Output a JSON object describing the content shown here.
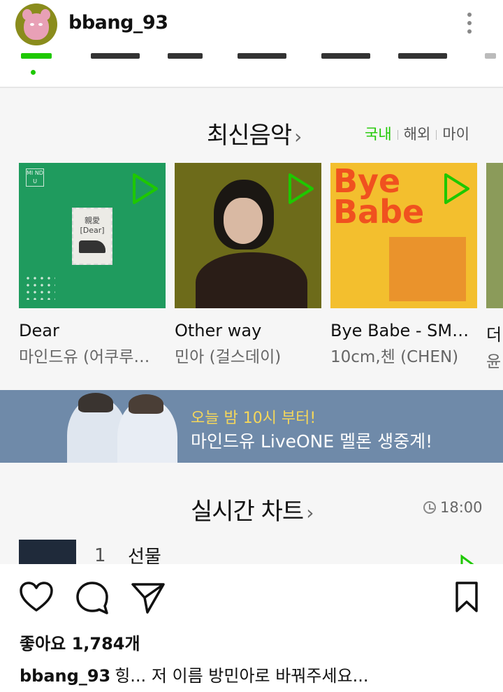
{
  "post": {
    "username": "bbang_93",
    "likes_label": "좋아요 1,784개",
    "caption_user": "bbang_93",
    "caption_text": "힝... 저 이름 방민아로 바꿔주세요..."
  },
  "melon": {
    "latest": {
      "title": "최신음악",
      "filters": [
        "국내",
        "해외",
        "마이"
      ],
      "active_filter": "국내",
      "albums": [
        {
          "title": "Dear",
          "artist": "마인드유 (어쿠루…",
          "art_text": "親愛 [Dear]"
        },
        {
          "title": "Other way",
          "artist": "민아 (걸스데이)"
        },
        {
          "title": "Bye Babe - SM…",
          "artist": "10cm,첸 (CHEN)",
          "art_text": "Bye Babe"
        },
        {
          "title": "더",
          "artist": "윤"
        }
      ]
    },
    "banner": {
      "line1": "오늘 밤 10시 부터!",
      "line2": "마인드유 LiveONE 멜론 생중계!"
    },
    "chart": {
      "title": "실시간 차트",
      "time": "18:00",
      "first_rank": "1",
      "first_title": "선물"
    },
    "colors": {
      "accent": "#1ec800",
      "banner": "#6f8aa9",
      "banner_highlight": "#f5d75a"
    }
  },
  "icons": [
    "more-vertical-icon",
    "play-icon",
    "heart-icon",
    "comment-icon",
    "share-icon",
    "bookmark-icon",
    "clock-icon"
  ]
}
